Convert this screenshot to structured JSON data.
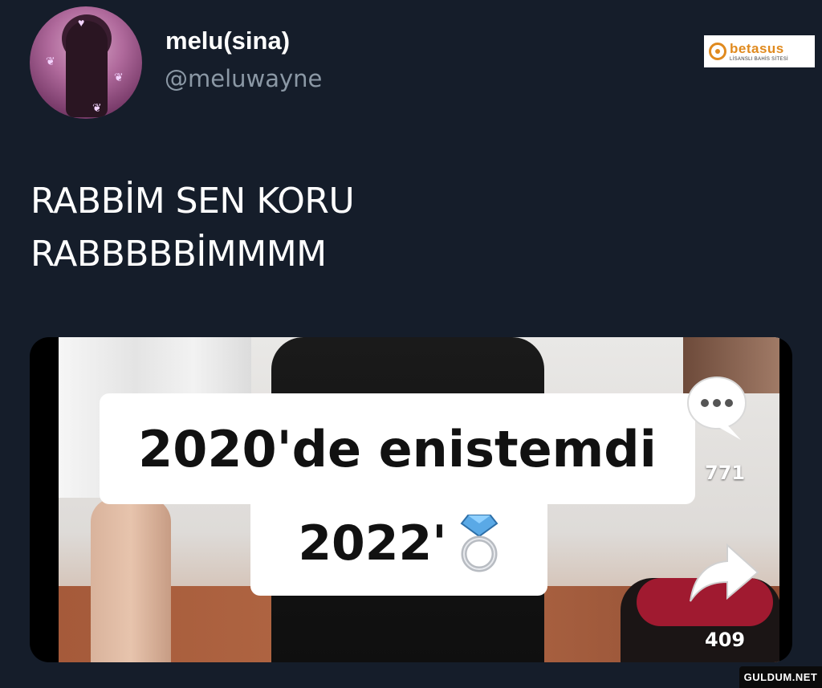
{
  "tweet": {
    "display_name": "melu(sina)",
    "handle": "@meluwayne",
    "text_line1": "RABBİM SEN KORU",
    "text_line2": "RABBBBBİMMMM"
  },
  "ad": {
    "brand": "betasus",
    "tagline": "LİSANSLI BAHİS SİTESİ"
  },
  "media": {
    "caption_line1": "2020'de enistemdi",
    "caption_line2": "2022'",
    "caption_emoji_icon": "ring-icon",
    "comment_icon": "comment-bubble-icon",
    "comment_count": "771",
    "share_icon": "share-arrow-icon",
    "share_count": "409"
  },
  "watermark": "GULDUM.NET"
}
